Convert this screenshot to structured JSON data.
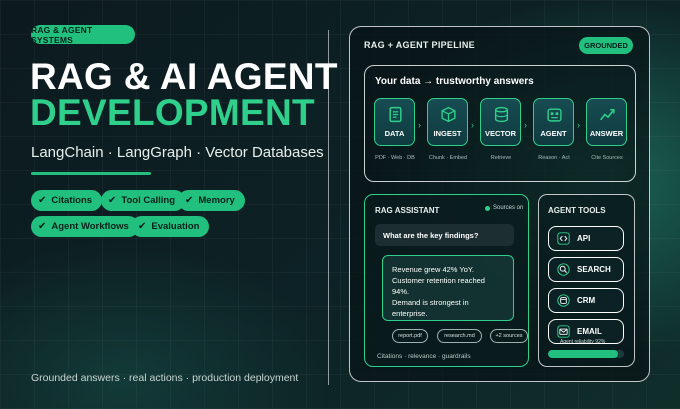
{
  "badge": "RAG & AGENT SYSTEMS",
  "title": {
    "line1": "RAG & AI AGENT",
    "line2": "DEVELOPMENT"
  },
  "subtitle": "LangChain · LangGraph · Vector Databases",
  "features": [
    "Citations",
    "Tool Calling",
    "Memory",
    "Agent Workflows",
    "Evaluation"
  ],
  "footer": "Grounded answers · real actions · production deployment",
  "pipeline": {
    "title": "RAG + AGENT PIPELINE",
    "status": "GROUNDED",
    "heading": "Your data → trustworthy answers",
    "stages": [
      {
        "label": "DATA",
        "sub": "PDF · Web · DB",
        "icon": "document-icon"
      },
      {
        "label": "INGEST",
        "sub": "Chunk · Embed",
        "icon": "cube-icon"
      },
      {
        "label": "VECTOR",
        "sub": "Retrieve",
        "icon": "database-icon"
      },
      {
        "label": "AGENT",
        "sub": "Reason · Act",
        "icon": "robot-icon"
      },
      {
        "label": "ANSWER",
        "sub": "Cite Sources",
        "icon": "trend-chart-icon"
      }
    ]
  },
  "assistant": {
    "title": "RAG ASSISTANT",
    "sources_status": "Sources on",
    "question": "What are the key findings?",
    "answer_lines": [
      "Revenue grew 42% YoY.",
      "Customer retention reached 94%.",
      "Demand is strongest in enterprise."
    ],
    "chips": [
      "report.pdf",
      "research.md",
      "+2 sources"
    ],
    "footer": "Citations · relevance · guardrails"
  },
  "tools": {
    "title": "AGENT TOOLS",
    "items": [
      {
        "label": "API",
        "icon": "code-icon"
      },
      {
        "label": "SEARCH",
        "icon": "search-icon"
      },
      {
        "label": "CRM",
        "icon": "database-icon"
      },
      {
        "label": "EMAIL",
        "icon": "mail-icon"
      }
    ],
    "reliability_label": "Agent reliability 92%",
    "reliability": 0.92
  },
  "colors": {
    "accent": "#22c07e",
    "accent_light": "#2fd08c",
    "background": "#0b1c1e"
  }
}
